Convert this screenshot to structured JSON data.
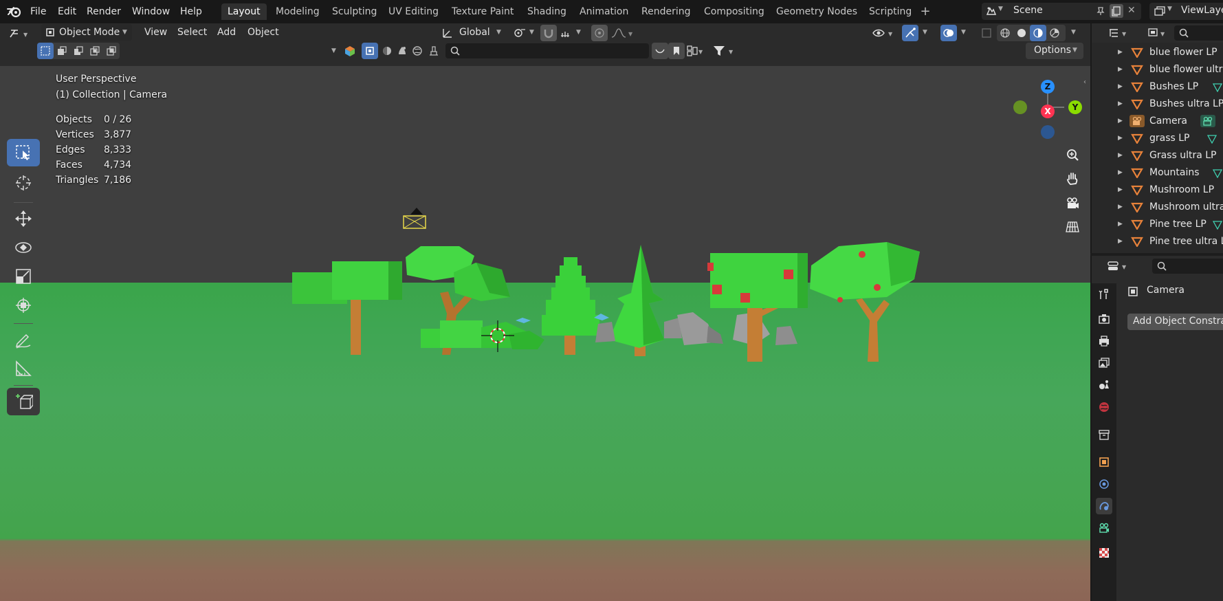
{
  "menu": {
    "file": "File",
    "edit": "Edit",
    "render": "Render",
    "window": "Window",
    "help": "Help"
  },
  "workspaces": [
    "Layout",
    "Modeling",
    "Sculpting",
    "UV Editing",
    "Texture Paint",
    "Shading",
    "Animation",
    "Rendering",
    "Compositing",
    "Geometry Nodes",
    "Scripting"
  ],
  "active_workspace": "Layout",
  "scene_name": "Scene",
  "view_layer": "ViewLayer",
  "viewport_header": {
    "mode": "Object Mode",
    "view": "View",
    "select": "Select",
    "add": "Add",
    "object": "Object",
    "transform_orientation": "Global",
    "options": "Options"
  },
  "overlay": {
    "perspective": "User Perspective",
    "collection": "(1) Collection | Camera",
    "stats": [
      {
        "label": "Objects",
        "value": "0 / 26"
      },
      {
        "label": "Vertices",
        "value": "3,877"
      },
      {
        "label": "Edges",
        "value": "8,333"
      },
      {
        "label": "Faces",
        "value": "4,734"
      },
      {
        "label": "Triangles",
        "value": "7,186"
      }
    ]
  },
  "gizmo": {
    "z": "Z",
    "y": "Y",
    "x": "X"
  },
  "outliner": {
    "items": [
      {
        "label": "blue flower LP",
        "type": "mesh"
      },
      {
        "label": "blue flower ultra",
        "type": "mesh"
      },
      {
        "label": "Bushes LP",
        "type": "mesh"
      },
      {
        "label": "Bushes ultra LP",
        "type": "mesh"
      },
      {
        "label": "Camera",
        "type": "camera"
      },
      {
        "label": "grass LP",
        "type": "mesh"
      },
      {
        "label": "Grass ultra LP",
        "type": "mesh"
      },
      {
        "label": "Mountains",
        "type": "mesh"
      },
      {
        "label": "Mushroom LP",
        "type": "mesh"
      },
      {
        "label": "Mushroom ultra LP",
        "type": "mesh"
      },
      {
        "label": "Pine tree LP",
        "type": "mesh"
      },
      {
        "label": "Pine tree ultra LP",
        "type": "mesh"
      }
    ]
  },
  "properties": {
    "object_name": "Camera",
    "add_constraint": "Add Object Constraint"
  },
  "colors": {
    "accent": "#4772b3",
    "axis_x": "#ff3352",
    "axis_y": "#8bdc00",
    "axis_z": "#2890ff",
    "mesh_icon": "#e8823a"
  }
}
